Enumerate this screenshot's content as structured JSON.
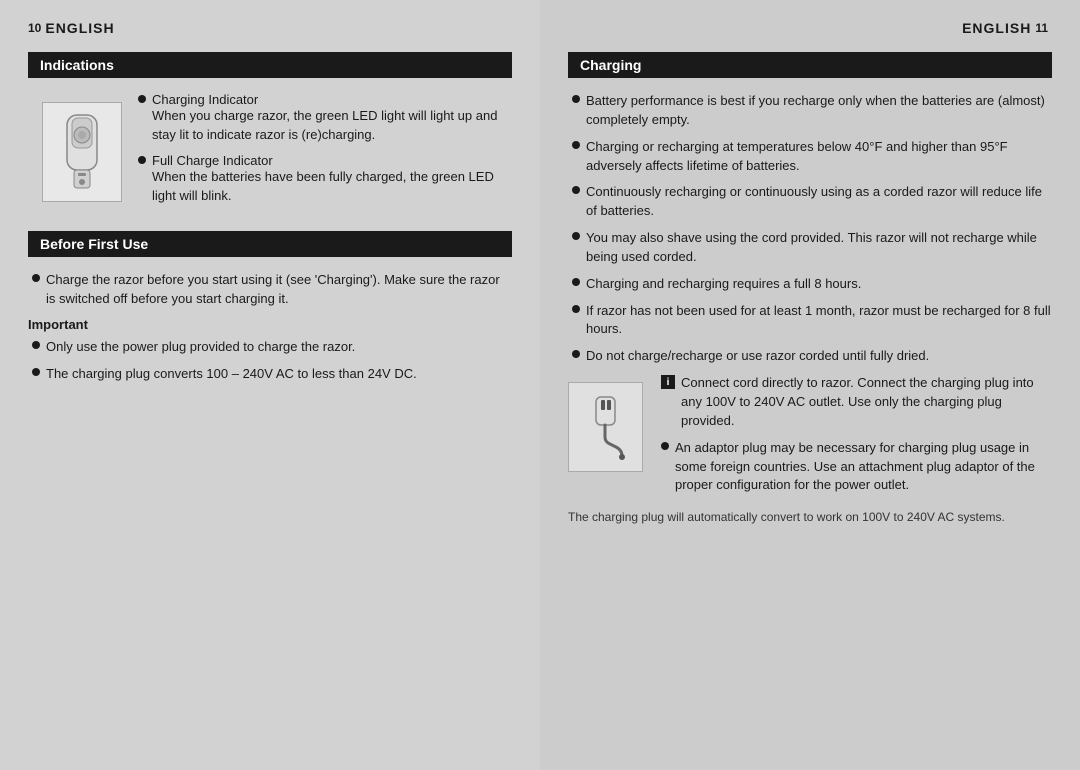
{
  "left": {
    "page_number": "10",
    "lang": "ENGLISH",
    "section1": {
      "title": "Indications",
      "items": [
        {
          "title": "Charging Indicator",
          "body": "When you charge razor, the green LED light will light up and stay lit to indicate razor is (re)charging."
        },
        {
          "title": "Full Charge Indicator",
          "body": "When the batteries have been fully charged, the green LED light will blink."
        }
      ]
    },
    "section2": {
      "title": "Before First Use",
      "intro": "Charge the razor before you start using it (see 'Charging'). Make sure the razor is switched off before you start charging it.",
      "important_label": "Important",
      "items": [
        "Only use the power plug provided to charge the razor.",
        "The charging plug converts 100 – 240V AC to less than 24V DC."
      ]
    }
  },
  "right": {
    "page_number": "11",
    "lang": "ENGLISH",
    "section": {
      "title": "Charging",
      "items": [
        "Battery performance is best if you recharge only when the batteries are (almost) completely empty.",
        "Charging or recharging at temperatures below 40°F and higher than 95°F adversely affects lifetime of batteries.",
        "Continuously recharging or continuously using as a corded razor will reduce life of batteries.",
        "You may also shave using the cord provided. This razor will not recharge while being used corded.",
        "Charging and recharging requires a full 8 hours.",
        "If razor has not been used for at least 1 month, razor must be recharged for 8 full hours.",
        "Do not charge/recharge or use razor corded until fully dried."
      ],
      "connect_item": "Connect cord directly to razor. Connect the charging plug into any 100V to 240V AC outlet. Use only the charging plug provided.",
      "adaptor_item": "An adaptor plug may be necessary for charging plug usage in some foreign countries. Use an attachment plug adaptor of the proper configuration for the power outlet.",
      "sub_text": "The charging plug will automatically convert to work on 100V to 240V AC systems."
    }
  }
}
